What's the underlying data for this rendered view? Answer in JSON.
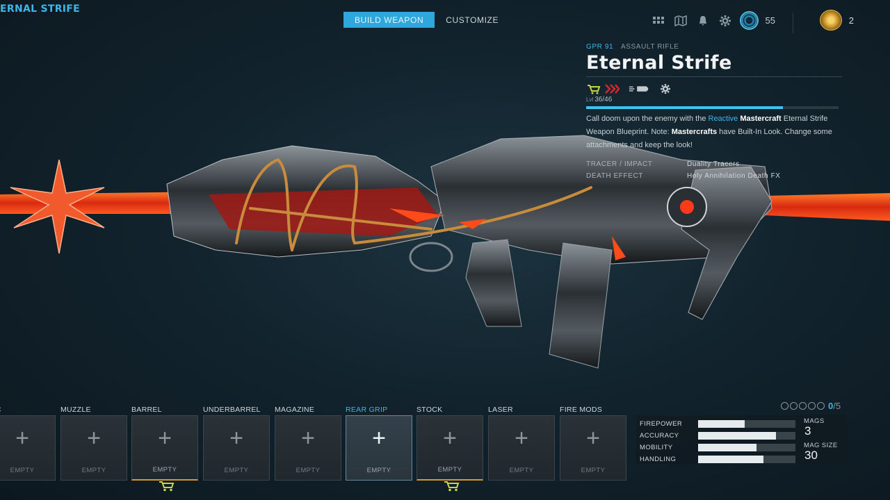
{
  "header": {
    "weapon_title_partial": "ERNAL STRIFE",
    "tabs": [
      {
        "label": "BUILD WEAPON",
        "active": true
      },
      {
        "label": "CUSTOMIZE",
        "active": false
      }
    ],
    "currency_count": "55",
    "token_count": "2"
  },
  "info": {
    "weapon_code": "GPR 91",
    "weapon_class": "ASSAULT RIFLE",
    "title": "Eternal Strife",
    "level_prefix": "Lvl",
    "level_text": "36/46",
    "level_progress": 0.78,
    "desc_1": "Call doom upon the enemy with the ",
    "desc_reactive": "Reactive",
    "desc_2": " ",
    "desc_mastercraft": "Mastercraft",
    "desc_3": " Eternal Strife Weapon Blueprint. Note: ",
    "desc_mastercrafts": "Mastercrafts",
    "desc_4": " have Built-In Look. Change some attachments and keep the look!",
    "tracer_label": "TRACER / IMPACT",
    "tracer_value": "Duality Tracers",
    "death_label": "DEATH EFFECT",
    "death_value": "Holy Annihilation Death FX"
  },
  "slots": [
    {
      "label": "TIC",
      "empty": "EMPTY"
    },
    {
      "label": "MUZZLE",
      "empty": "EMPTY"
    },
    {
      "label": "BARREL",
      "empty": "EMPTY"
    },
    {
      "label": "UNDERBARREL",
      "empty": "EMPTY"
    },
    {
      "label": "MAGAZINE",
      "empty": "EMPTY"
    },
    {
      "label": "REAR GRIP",
      "empty": "EMPTY"
    },
    {
      "label": "STOCK",
      "empty": "EMPTY"
    },
    {
      "label": "LASER",
      "empty": "EMPTY"
    },
    {
      "label": "FIRE MODS",
      "empty": "EMPTY"
    }
  ],
  "attachments": {
    "count": "0",
    "total": "/5"
  },
  "stats": {
    "rows": [
      {
        "name": "FIREPOWER",
        "value": 0.48
      },
      {
        "name": "ACCURACY",
        "value": 0.8
      },
      {
        "name": "MOBILITY",
        "value": 0.6
      },
      {
        "name": "HANDLING",
        "value": 0.67
      }
    ],
    "mags_label": "MAGS",
    "mags_value": "3",
    "mag_size_label": "MAG SIZE",
    "mag_size_value": "30"
  },
  "colors": {
    "accent": "#3fb6e8",
    "gold": "#d5972f"
  }
}
